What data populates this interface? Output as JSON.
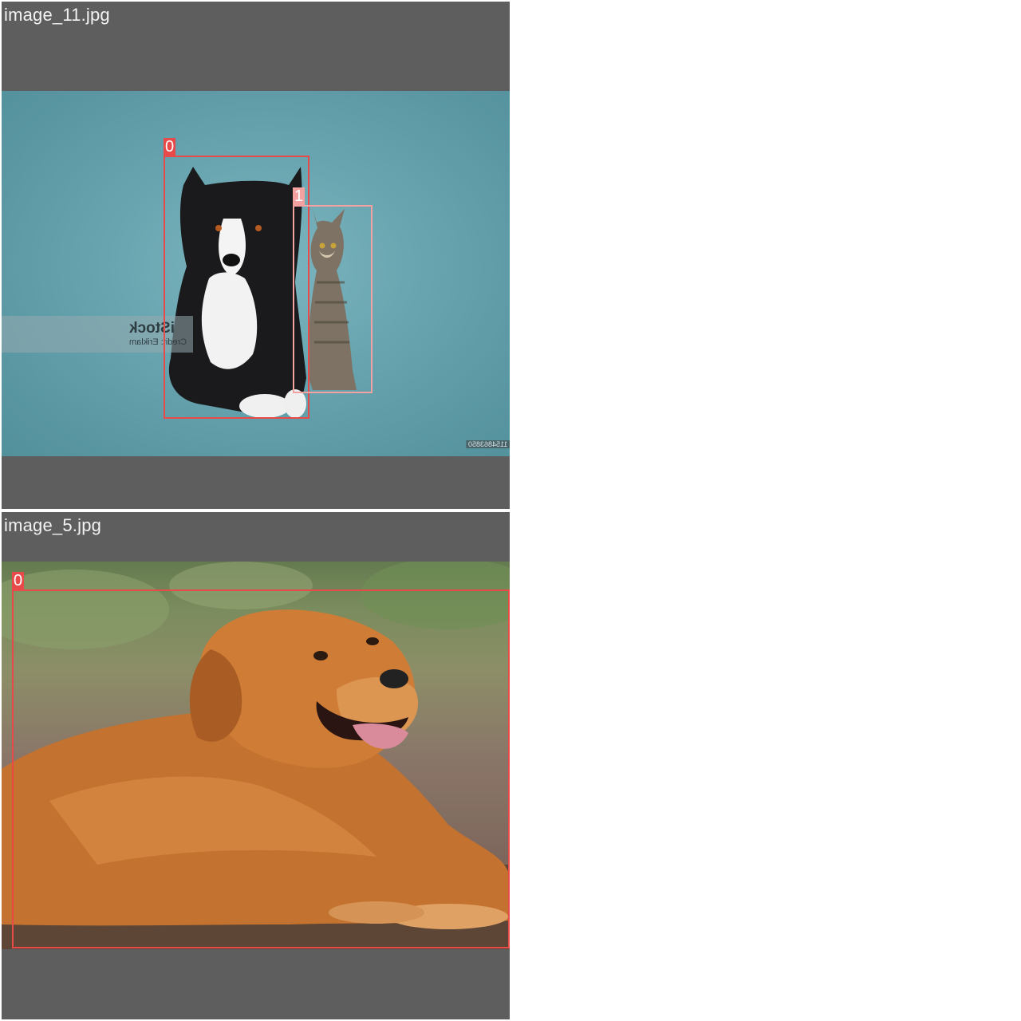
{
  "tiles": [
    {
      "filename": "image_11.jpg",
      "photo": "dog-and-cat-photo",
      "watermark": {
        "brand": "iStock",
        "credit": "Credit: Eriklаm",
        "id": "1154863850"
      },
      "detections": [
        {
          "label": "0",
          "object": "dog"
        },
        {
          "label": "1",
          "object": "cat"
        }
      ]
    },
    {
      "filename": "image_5.jpg",
      "photo": "golden-retriever-photo",
      "detections": [
        {
          "label": "0",
          "object": "dog"
        }
      ]
    }
  ],
  "colors": {
    "tile_background": "#5e5e5e",
    "box_class_0": "#e84a4a",
    "box_class_1": "#f4a1a1",
    "filename_text": "#f2f2f2"
  }
}
